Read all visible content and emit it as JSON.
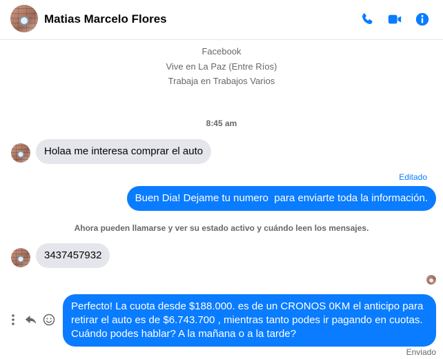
{
  "header": {
    "contact_name": "Matias Marcelo Flores",
    "icons": [
      "phone-icon",
      "video-camera-icon",
      "info-icon"
    ],
    "accent_color": "#0a7cff"
  },
  "intro": {
    "source": "Facebook",
    "location": "Vive en La Paz (Entre Ríos)",
    "work": "Trabaja en Trabajos Varios"
  },
  "conversation": {
    "timestamp": "8:45 am",
    "messages": [
      {
        "direction": "incoming",
        "text": "Holaa me interesa comprar el auto"
      },
      {
        "direction": "outgoing",
        "status": "Editado",
        "text": "Buen Dia! Dejame tu numero  para enviarte toda la información."
      },
      {
        "direction": "incoming",
        "text": "3437457932"
      },
      {
        "direction": "outgoing",
        "status": "Enviado",
        "text": "Perfecto! La cuota desde $188.000. es de un CRONOS 0KM el anticipo para retirar el auto es de $6.743.700 , mientras tanto podes ir pagando en cuotas. Cuándo podes hablar? A la mañana o a la tarde?"
      }
    ],
    "system_note": "Ahora pueden llamarse y ver su estado activo y cuándo leen los mensajes.",
    "message_action_icons": [
      "more-options-icon",
      "reply-icon",
      "emoji-reaction-icon"
    ]
  },
  "colors": {
    "outgoing_bubble": "#0a7cff",
    "incoming_bubble": "#e4e6eb",
    "secondary_text": "#65676b"
  }
}
